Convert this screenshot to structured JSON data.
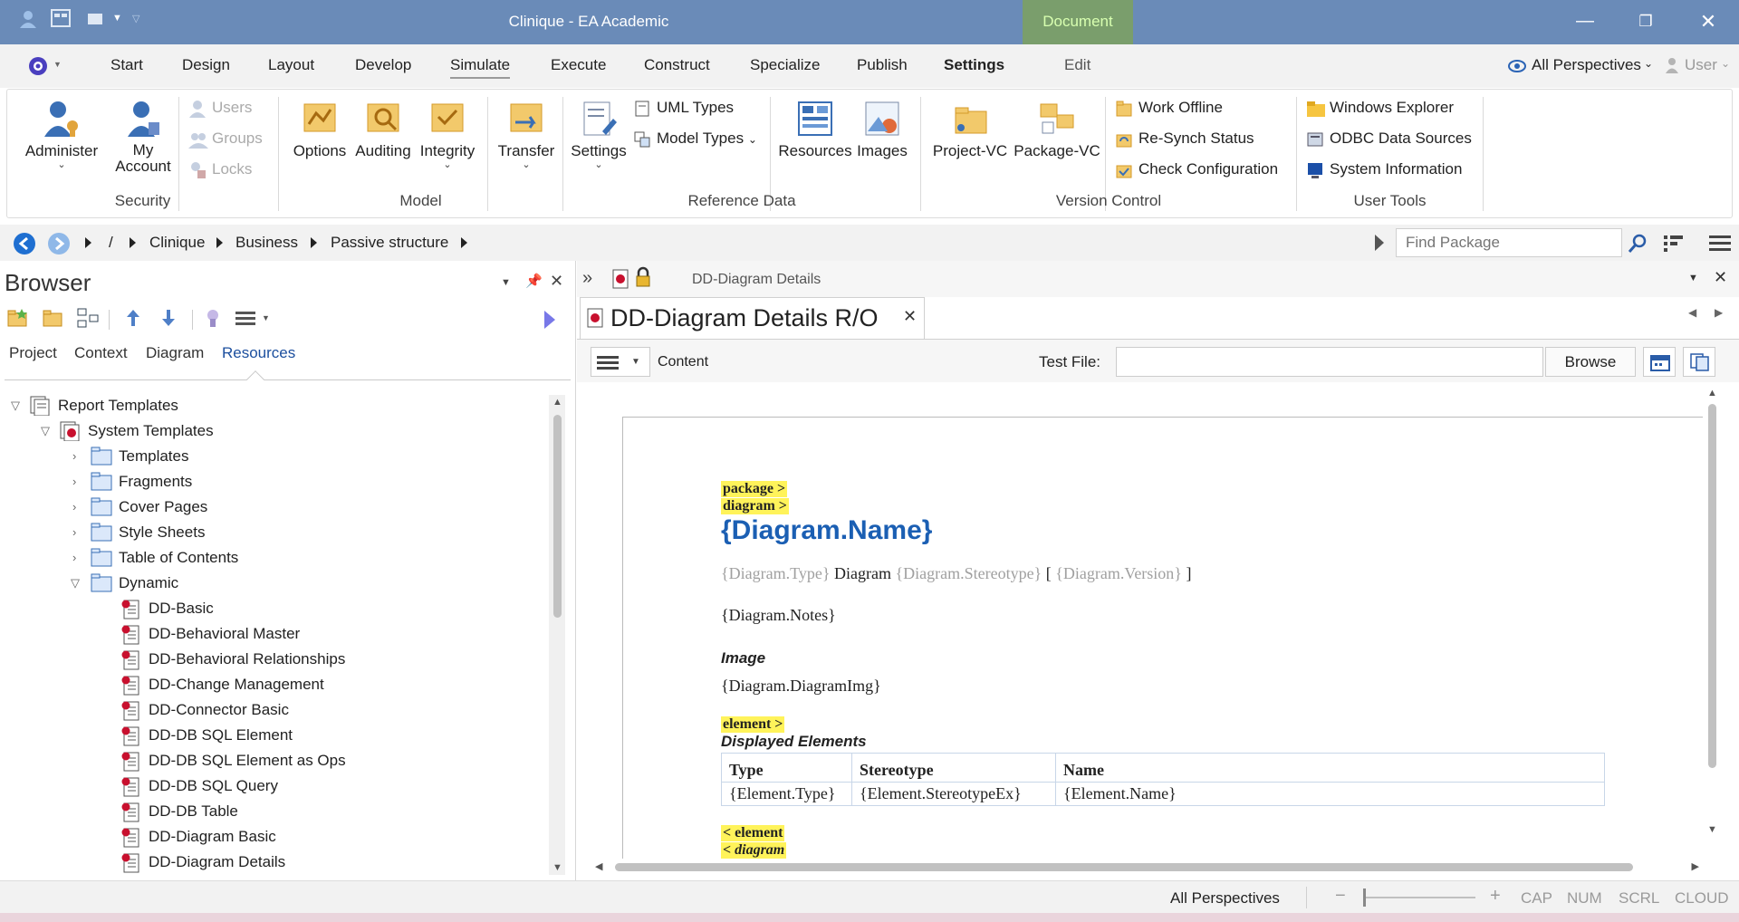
{
  "titlebar": {
    "title": "Clinique - EA Academic",
    "context_tab": "Document"
  },
  "menu": {
    "items": [
      "Start",
      "Design",
      "Layout",
      "Develop",
      "Simulate",
      "Execute",
      "Construct",
      "Specialize",
      "Publish",
      "Settings",
      "Edit"
    ],
    "active": "Settings",
    "perspectives": "All Perspectives",
    "user": "User"
  },
  "ribbon": {
    "security": {
      "title": "Security",
      "administer": "Administer",
      "my_account": "My Account",
      "users": "Users",
      "groups": "Groups",
      "locks": "Locks"
    },
    "model": {
      "title": "Model",
      "options": "Options",
      "auditing": "Auditing",
      "integrity": "Integrity",
      "transfer": "Transfer"
    },
    "reference": {
      "title": "Reference Data",
      "settings": "Settings",
      "uml_types": "UML Types",
      "model_types": "Model Types",
      "resources": "Resources",
      "images": "Images"
    },
    "version": {
      "title": "Version Control",
      "project_vc": "Project-VC",
      "package_vc": "Package-VC",
      "work_offline": "Work Offline",
      "resynch": "Re-Synch Status",
      "check_config": "Check Configuration"
    },
    "usertools": {
      "title": "User Tools",
      "windows_explorer": "Windows Explorer",
      "odbc": "ODBC Data Sources",
      "sysinfo": "System Information"
    }
  },
  "breadcrumb": {
    "root": "/",
    "items": [
      "Clinique",
      "Business",
      "Passive structure"
    ],
    "find_placeholder": "Find Package"
  },
  "browser": {
    "title": "Browser",
    "tabs": [
      "Project",
      "Context",
      "Diagram",
      "Resources"
    ],
    "selected_tab": "Resources",
    "tree": {
      "report_templates": "Report Templates",
      "system_templates": "System Templates",
      "folders": [
        "Templates",
        "Fragments",
        "Cover Pages",
        "Style Sheets",
        "Table of Contents"
      ],
      "dynamic": "Dynamic",
      "dynamic_items": [
        "DD-Basic",
        "DD-Behavioral Master",
        "DD-Behavioral Relationships",
        "DD-Change Management",
        "DD-Connector Basic",
        "DD-DB SQL Element",
        "DD-DB SQL Element as Ops",
        "DD-DB SQL Query",
        "DD-DB Table",
        "DD-Diagram Basic",
        "DD-Diagram Details"
      ]
    }
  },
  "docpanel": {
    "header_title": "DD-Diagram Details",
    "tab_title": "DD-Diagram Details R/O",
    "content_label": "Content",
    "test_file_label": "Test File:",
    "test_file_value": "",
    "browse_label": "Browse",
    "doc": {
      "tag_package": "package >",
      "tag_diagram": "diagram >",
      "diagram_name": "{Diagram.Name}",
      "type_field": "{Diagram.Type}",
      "diagram_word": "Diagram",
      "stereo_field": "{Diagram.Stereotype}",
      "open_bracket": "[",
      "version_field": "{Diagram.Version}",
      "close_bracket": "]",
      "notes": "{Diagram.Notes}",
      "image_heading": "Image",
      "diagram_img": "{Diagram.DiagramImg}",
      "tag_element": "element >",
      "displayed_heading": "Displayed Elements",
      "table_headers": [
        "Type",
        "Stereotype",
        "Name"
      ],
      "table_row": [
        "{Element.Type}",
        "{Element.StereotypeEx}",
        "{Element.Name}"
      ],
      "tag_end_element": "< element",
      "tag_end_diagram": "< diagram"
    }
  },
  "statusbar": {
    "perspectives": "All Perspectives",
    "minus": "−",
    "plus": "+",
    "cap": "CAP",
    "num": "NUM",
    "scrl": "SCRL",
    "cloud": "CLOUD"
  }
}
